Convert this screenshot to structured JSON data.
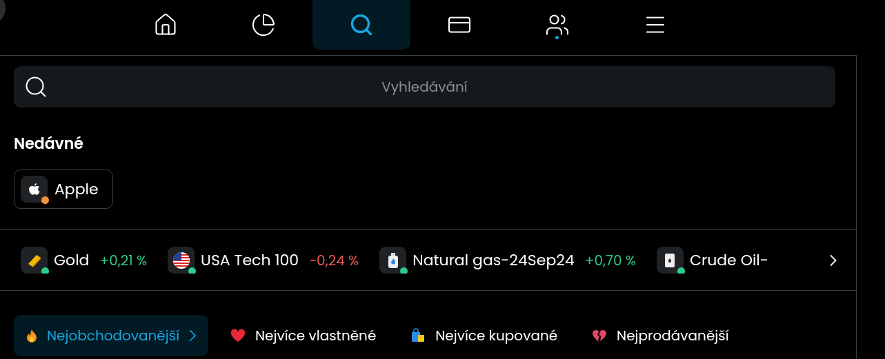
{
  "nav": [
    {
      "selected": false,
      "dot": false
    },
    {
      "selected": false,
      "dot": false
    },
    {
      "selected": true,
      "dot": false
    },
    {
      "selected": false,
      "dot": false
    },
    {
      "selected": false,
      "dot": true
    },
    {
      "selected": false,
      "dot": false
    }
  ],
  "search": {
    "placeholder": "Vyhledávání"
  },
  "recent": {
    "title": "Nedávné",
    "items": [
      {
        "name": "Apple",
        "color": "#f6923e"
      }
    ]
  },
  "ticker": [
    {
      "name": "Gold",
      "color": "#2ecc8a",
      "change": {
        "text": "+0,21 %",
        "color": "#2ecc8a"
      }
    },
    {
      "name": "USA Tech 100",
      "color": "#2ecc8a",
      "change": {
        "text": "−0,24 %",
        "color": "#f0585a"
      }
    },
    {
      "name": "Natural gas-24Sep24",
      "color": "#2ecc8a",
      "change": {
        "text": "+0,70 %",
        "color": "#2ecc8a"
      }
    },
    {
      "name": "Crude Oil-",
      "color": "#2ecc8a"
    }
  ],
  "tabs": [
    {
      "label": "Nejobchodovanější",
      "selected": true
    },
    {
      "label": "Nejvíce vlastněné",
      "selected": false
    },
    {
      "label": "Nejvíce kupované",
      "selected": false
    },
    {
      "label": "Nejprodávanější",
      "selected": false
    }
  ]
}
